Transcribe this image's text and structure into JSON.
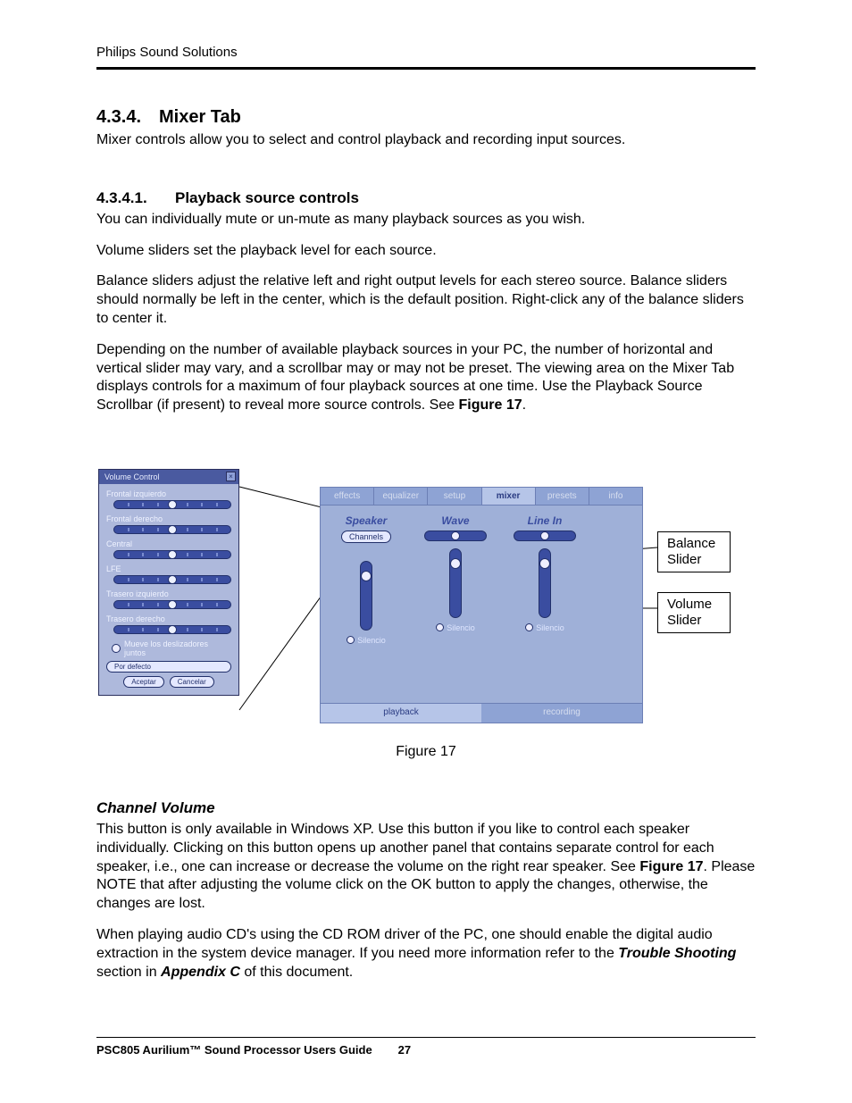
{
  "header": {
    "running": "Philips Sound Solutions"
  },
  "section": {
    "num": "4.3.4.",
    "title": "Mixer Tab",
    "intro": "Mixer controls allow you to select and control playback and recording input sources."
  },
  "subsection": {
    "num": "4.3.4.1.",
    "title": "Playback source controls",
    "p1": "You can individually mute or un-mute as many playback sources as you wish.",
    "p2": "Volume sliders set the playback level for each source.",
    "p3": "Balance sliders adjust the relative left and right output levels for each stereo source. Balance sliders should normally be left in the center, which is the default position. Right-click any of the balance sliders to center it.",
    "p4a": "Depending on the number of available playback sources in your PC, the number of horizontal and vertical slider may vary, and a scrollbar may or may not be preset. The viewing area on the Mixer Tab displays controls for a maximum of four playback sources at one time.  Use the Playback Source Scrollbar (if present) to reveal more source controls. See ",
    "p4b": "Figure 17",
    "p4c": "."
  },
  "figure": {
    "caption": "Figure 17",
    "callouts": {
      "balance": "Balance Slider",
      "volume": "Volume Slider"
    },
    "volume_control": {
      "title": "Volume Control",
      "channels": [
        "Frontal izquierdo",
        "Frontal derecho",
        "Central",
        "LFE",
        "Trasero izquierdo",
        "Trasero derecho"
      ],
      "link_label": "Mueve los deslizadores juntos",
      "default_btn": "Por defecto",
      "ok_btn": "Aceptar",
      "cancel_btn": "Cancelar"
    },
    "mixer": {
      "tabs": [
        "effects",
        "equalizer",
        "setup",
        "mixer",
        "presets",
        "info"
      ],
      "active_tab": "mixer",
      "columns": [
        {
          "title": "Speaker",
          "channels_btn": "Channels",
          "mute": "Silencio"
        },
        {
          "title": "Wave",
          "mute": "Silencio"
        },
        {
          "title": "Line In",
          "mute": "Silencio"
        }
      ],
      "bottom": {
        "playback": "playback",
        "recording": "recording",
        "active": "playback"
      }
    }
  },
  "chanvol": {
    "title": "Channel Volume",
    "p1a": "This button is only available in Windows XP. Use this button if you like to control each speaker individually.  Clicking on this button opens up another panel that contains separate control for each speaker, i.e., one can increase or decrease the volume on the right rear speaker. See ",
    "p1b": "Figure 17",
    "p1c": ".  Please NOTE that after adjusting the volume click on the OK button to apply the changes, otherwise, the changes are lost.",
    "p2a": "When playing audio CD's using the CD ROM driver of the PC, one should enable the digital audio extraction in the system device manager. If you need more information refer to the ",
    "p2b": "Trouble Shooting",
    "p2c": " section in ",
    "p2d": "Appendix C",
    "p2e": " of this document."
  },
  "footer": {
    "text": "PSC805 Aurilium™ Sound Processor Users Guide",
    "page": "27"
  }
}
